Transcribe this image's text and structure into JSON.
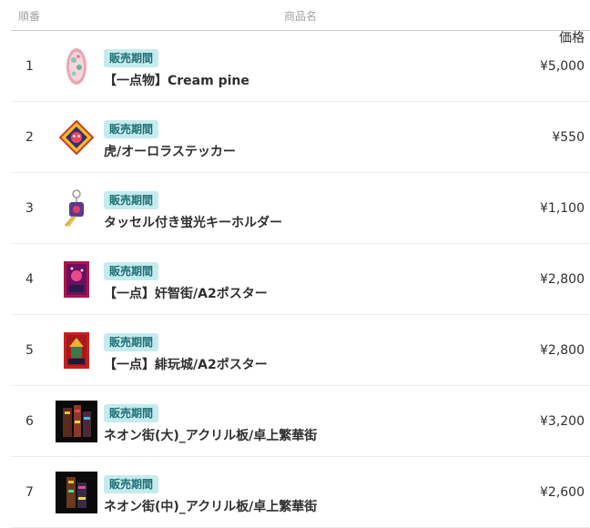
{
  "header": {
    "index_label": "順番",
    "name_label": "商品名",
    "price_label": "価格"
  },
  "rows": [
    {
      "index": "1",
      "badge": "販売期間",
      "name": "【一点物】Cream pine",
      "price": "¥5,000",
      "thumb_icon": "cream-pine-thumbnail-icon"
    },
    {
      "index": "2",
      "badge": "販売期間",
      "name": "虎/オーロラステッカー",
      "price": "¥550",
      "thumb_icon": "tiger-sticker-thumbnail-icon"
    },
    {
      "index": "3",
      "badge": "販売期間",
      "name": "タッセル付き蛍光キーホルダー",
      "price": "¥1,100",
      "thumb_icon": "tassel-keychain-thumbnail-icon"
    },
    {
      "index": "4",
      "badge": "販売期間",
      "name": "【一点】奸智街/A2ポスター",
      "price": "¥2,800",
      "thumb_icon": "poster-kanchigai-thumbnail-icon"
    },
    {
      "index": "5",
      "badge": "販売期間",
      "name": "【一点】緋玩城/A2ポスター",
      "price": "¥2,800",
      "thumb_icon": "poster-higanjo-thumbnail-icon"
    },
    {
      "index": "6",
      "badge": "販売期間",
      "name": "ネオン街(大)_アクリル板/卓上繁華街",
      "price": "¥3,200",
      "thumb_icon": "neon-town-large-thumbnail-icon"
    },
    {
      "index": "7",
      "badge": "販売期間",
      "name": "ネオン街(中)_アクリル板/卓上繁華街",
      "price": "¥2,600",
      "thumb_icon": "neon-town-medium-thumbnail-icon"
    }
  ]
}
